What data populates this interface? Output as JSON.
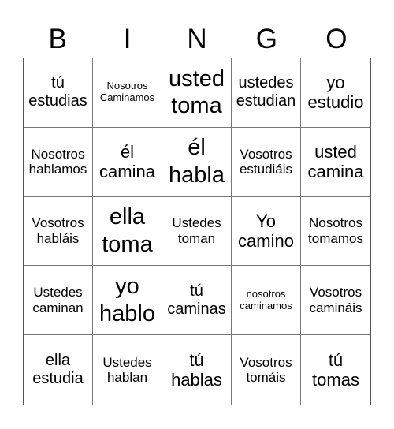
{
  "header": {
    "letters": [
      "B",
      "I",
      "N",
      "G",
      "O"
    ]
  },
  "cells": [
    {
      "text": "tú estudias",
      "size": "md"
    },
    {
      "text": "Nosotros Caminamos",
      "size": "xs"
    },
    {
      "text": "usted toma",
      "size": "xl"
    },
    {
      "text": "ustedes estudian",
      "size": "md"
    },
    {
      "text": "yo estudio",
      "size": "lg"
    },
    {
      "text": "Nosotros hablamos",
      "size": "sm"
    },
    {
      "text": "él camina",
      "size": "lg"
    },
    {
      "text": "él habla",
      "size": "xl"
    },
    {
      "text": "Vosotros estudiáis",
      "size": "sm"
    },
    {
      "text": "usted camina",
      "size": "lg"
    },
    {
      "text": "Vosotros habláis",
      "size": "sm"
    },
    {
      "text": "ella toma",
      "size": "xl"
    },
    {
      "text": "Ustedes toman",
      "size": "sm"
    },
    {
      "text": "Yo camino",
      "size": "lg"
    },
    {
      "text": "Nosotros tomamos",
      "size": "sm"
    },
    {
      "text": "Ustedes caminan",
      "size": "sm"
    },
    {
      "text": "yo hablo",
      "size": "xl"
    },
    {
      "text": "tú caminas",
      "size": "md"
    },
    {
      "text": "nosotros caminamos",
      "size": "xs"
    },
    {
      "text": "Vosotros camináis",
      "size": "sm"
    },
    {
      "text": "ella estudia",
      "size": "md"
    },
    {
      "text": "Ustedes hablan",
      "size": "sm"
    },
    {
      "text": "tú hablas",
      "size": "lg"
    },
    {
      "text": "Vosotros tomáis",
      "size": "sm"
    },
    {
      "text": "tú tomas",
      "size": "lg"
    }
  ]
}
